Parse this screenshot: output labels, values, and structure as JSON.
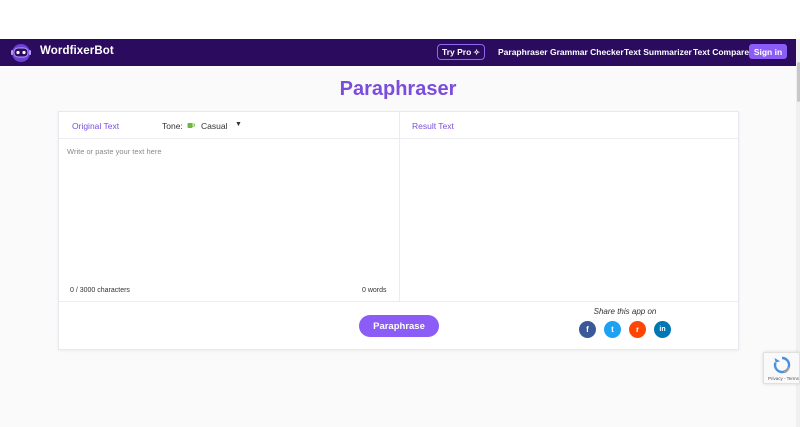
{
  "brand": {
    "name": "WordfixerBot"
  },
  "nav": {
    "try_pro": "Try Pro",
    "links": [
      "Paraphraser",
      "Grammar Checker",
      "Text Summarizer",
      "Text Compare"
    ],
    "signin": "Sign in"
  },
  "page": {
    "title": "Paraphraser"
  },
  "editor": {
    "original_label": "Original Text",
    "tone_label": "Tone:",
    "tone_value": "Casual",
    "placeholder": "Write or paste your text here",
    "char_count": "0 / 3000 characters",
    "word_count": "0 words",
    "result_label": "Result Text"
  },
  "actions": {
    "paraphrase": "Paraphrase"
  },
  "share": {
    "title": "Share this app on",
    "networks": [
      {
        "icon": "facebook-icon",
        "glyph": "f",
        "color": "#3b5998"
      },
      {
        "icon": "twitter-icon",
        "glyph": "t",
        "color": "#1da1f2"
      },
      {
        "icon": "reddit-icon",
        "glyph": "r",
        "color": "#ff4500"
      },
      {
        "icon": "linkedin-icon",
        "glyph": "in",
        "color": "#0077b5"
      }
    ]
  },
  "recaptcha": {
    "terms": "Privacy - Terms"
  },
  "colors": {
    "navbar": "#2a0b5e",
    "accent": "#8b5cf6",
    "title": "#7c4ddc"
  }
}
